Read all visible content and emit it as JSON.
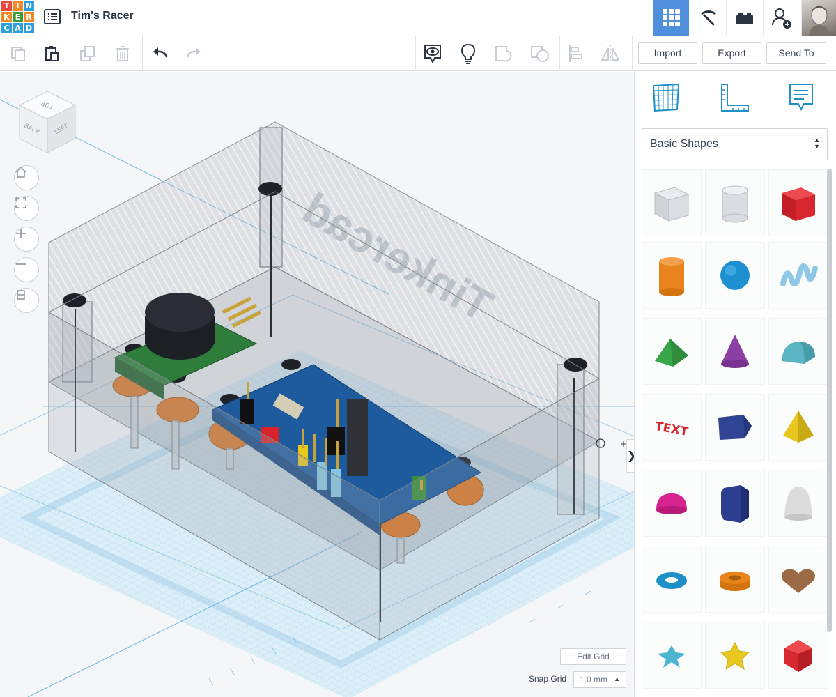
{
  "app": {
    "logo_letters": [
      "T",
      "I",
      "N",
      "K",
      "E",
      "R",
      "C",
      "A",
      "D"
    ],
    "design_title": "Tim's Racer",
    "icons": {
      "menu": "design-list-icon",
      "view_3d": "3d-design-grid-icon",
      "codeblocks": "pickaxe-icon",
      "lego": "bricks-icon",
      "invite": "add-user-icon",
      "profile": "user-avatar"
    },
    "colors": {
      "accent": "#4f8fdc",
      "grid": "#b9dcef"
    }
  },
  "toolbar": {
    "tools": [
      "copy-icon",
      "paste-icon",
      "duplicate-icon",
      "delete-icon",
      "undo-icon",
      "redo-icon",
      "notes-visibility-icon",
      "lightbulb-icon",
      "group-icon",
      "ungroup-icon",
      "align-icon",
      "mirror-icon"
    ],
    "import_label": "Import",
    "export_label": "Export",
    "send_to_label": "Send To"
  },
  "viewcube": {
    "top": "TOP",
    "back": "BACK",
    "left": "LEFT"
  },
  "nav_buttons": [
    "home-view-icon",
    "fit-view-icon",
    "zoom-in-icon",
    "zoom-out-icon",
    "perspective-icon"
  ],
  "workplane": {
    "edit_grid_label": "Edit Grid",
    "snap_grid_label": "Snap Grid",
    "snap_value": "1.0 mm",
    "watermark_text": "Tinkercad"
  },
  "panel": {
    "tabs": [
      "workplane-icon",
      "ruler-icon",
      "notes-icon"
    ],
    "category": "Basic Shapes",
    "shapes": [
      [
        "box-hole",
        "cylinder-hole",
        "box"
      ],
      [
        "cylinder",
        "sphere",
        "scribble"
      ],
      [
        "roof",
        "cone",
        "round-roof"
      ],
      [
        "text",
        "polygon-wedge",
        "pyramid"
      ],
      [
        "half-sphere",
        "polygon",
        "paraboloid"
      ],
      [
        "torus",
        "tube",
        "heart"
      ],
      [
        "star",
        "star-3d",
        "icosahedron"
      ]
    ],
    "shape_colors": {
      "box": "#d7282f",
      "cylinder": "#e9831c",
      "sphere": "#1e8fd0",
      "scribble": "#8fc7e6",
      "roof": "#3aa64a",
      "cone": "#8b3fa3",
      "round-roof": "#5bb4c4",
      "text": "#d7282f",
      "polygon-wedge": "#2f4593",
      "pyramid": "#e8c81e",
      "half-sphere": "#d6238f",
      "polygon": "#2c3f8f",
      "paraboloid": "#dcdcdc",
      "torus": "#1f8fc8",
      "tube": "#e9831c",
      "heart": "#9b6a45",
      "star": "#4cb3d0",
      "star-3d": "#e8c81e",
      "icosahedron": "#d7282f"
    },
    "text_shape_label": "TEXT"
  }
}
